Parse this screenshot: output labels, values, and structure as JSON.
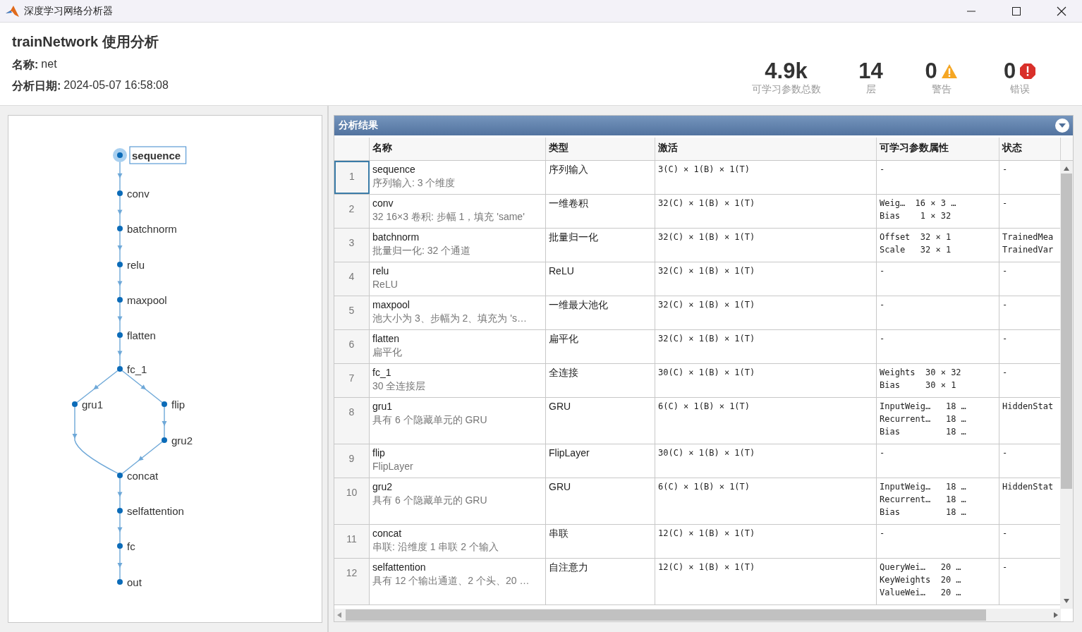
{
  "window": {
    "title": "深度学习网络分析器"
  },
  "report": {
    "title": "trainNetwork 使用分析",
    "name_label": "名称:",
    "name": "net",
    "date_label": "分析日期:",
    "date": "2024-05-07 16:58:08"
  },
  "summary": [
    {
      "value": "4.9k",
      "label": "可学习参数总数",
      "kind": "plain"
    },
    {
      "value": "14",
      "label": "层",
      "kind": "plain"
    },
    {
      "value": "0",
      "label": "警告",
      "kind": "warning"
    },
    {
      "value": "0",
      "label": "错误",
      "kind": "error"
    }
  ],
  "graph": {
    "nodes": [
      {
        "name": "sequence",
        "selected": true
      },
      {
        "name": "conv",
        "selected": false
      },
      {
        "name": "batchnorm",
        "selected": false
      },
      {
        "name": "relu",
        "selected": false
      },
      {
        "name": "maxpool",
        "selected": false
      },
      {
        "name": "flatten",
        "selected": false
      },
      {
        "name": "fc_1",
        "selected": false
      },
      {
        "name": "gru1",
        "selected": false
      },
      {
        "name": "flip",
        "selected": false
      },
      {
        "name": "gru2",
        "selected": false
      },
      {
        "name": "concat",
        "selected": false
      },
      {
        "name": "selfattention",
        "selected": false
      },
      {
        "name": "fc",
        "selected": false
      },
      {
        "name": "out",
        "selected": false
      }
    ]
  },
  "results": {
    "title": "分析结果",
    "columns": [
      "名称",
      "类型",
      "激活",
      "可学习参数属性",
      "状态"
    ],
    "rows": [
      {
        "index": "1",
        "name": "sequence",
        "description": "序列输入: 3 个维度",
        "type": "序列输入",
        "activation": "3(C) × 1(B) × 1(T)",
        "learnables": [
          "-"
        ],
        "states": [
          "-"
        ],
        "selected": true
      },
      {
        "index": "2",
        "name": "conv",
        "description": "32 16×3 卷积: 步幅 1，填充 'same'",
        "type": "一维卷积",
        "activation": "32(C) × 1(B) × 1(T)",
        "learnables": [
          "Weig…  16 × 3 …",
          "Bias    1 × 32"
        ],
        "states": [
          "-"
        ],
        "selected": false
      },
      {
        "index": "3",
        "name": "batchnorm",
        "description": "批量归一化: 32 个通道",
        "type": "批量归一化",
        "activation": "32(C) × 1(B) × 1(T)",
        "learnables": [
          "Offset  32 × 1",
          "Scale   32 × 1"
        ],
        "states": [
          "TrainedMea",
          "TrainedVar"
        ],
        "selected": false
      },
      {
        "index": "4",
        "name": "relu",
        "description": "ReLU",
        "type": "ReLU",
        "activation": "32(C) × 1(B) × 1(T)",
        "learnables": [
          "-"
        ],
        "states": [
          "-"
        ],
        "selected": false
      },
      {
        "index": "5",
        "name": "maxpool",
        "description": "池大小为 3、步幅为 2、填充为 's…",
        "type": "一维最大池化",
        "activation": "32(C) × 1(B) × 1(T)",
        "learnables": [
          "-"
        ],
        "states": [
          "-"
        ],
        "selected": false
      },
      {
        "index": "6",
        "name": "flatten",
        "description": "扁平化",
        "type": "扁平化",
        "activation": "32(C) × 1(B) × 1(T)",
        "learnables": [
          "-"
        ],
        "states": [
          "-"
        ],
        "selected": false
      },
      {
        "index": "7",
        "name": "fc_1",
        "description": "30 全连接层",
        "type": "全连接",
        "activation": "30(C) × 1(B) × 1(T)",
        "learnables": [
          "Weights  30 × 32",
          "Bias     30 × 1"
        ],
        "states": [
          "-"
        ],
        "selected": false
      },
      {
        "index": "8",
        "name": "gru1",
        "description": "具有 6 个隐藏单元的 GRU",
        "type": "GRU",
        "activation": "6(C) × 1(B) × 1(T)",
        "learnables": [
          "InputWeig…   18 …",
          "Recurrent…   18 …",
          "Bias         18 …"
        ],
        "states": [
          "HiddenStat"
        ],
        "selected": false
      },
      {
        "index": "9",
        "name": "flip",
        "description": "FlipLayer",
        "type": "FlipLayer",
        "activation": "30(C) × 1(B) × 1(T)",
        "learnables": [
          "-"
        ],
        "states": [
          "-"
        ],
        "selected": false
      },
      {
        "index": "10",
        "name": "gru2",
        "description": "具有 6 个隐藏单元的 GRU",
        "type": "GRU",
        "activation": "6(C) × 1(B) × 1(T)",
        "learnables": [
          "InputWeig…   18 …",
          "Recurrent…   18 …",
          "Bias         18 …"
        ],
        "states": [
          "HiddenStat"
        ],
        "selected": false
      },
      {
        "index": "11",
        "name": "concat",
        "description": "串联: 沿维度 1 串联 2 个输入",
        "type": "串联",
        "activation": "12(C) × 1(B) × 1(T)",
        "learnables": [
          "-"
        ],
        "states": [
          "-"
        ],
        "selected": false
      },
      {
        "index": "12",
        "name": "selfattention",
        "description": "具有 12 个输出通道、2 个头、20 …",
        "type": "自注意力",
        "activation": "12(C) × 1(B) × 1(T)",
        "learnables": [
          "QueryWei…   20 …",
          "KeyWeights  20 …",
          "ValueWei…   20 …"
        ],
        "states": [
          "-"
        ],
        "selected": false
      }
    ]
  }
}
